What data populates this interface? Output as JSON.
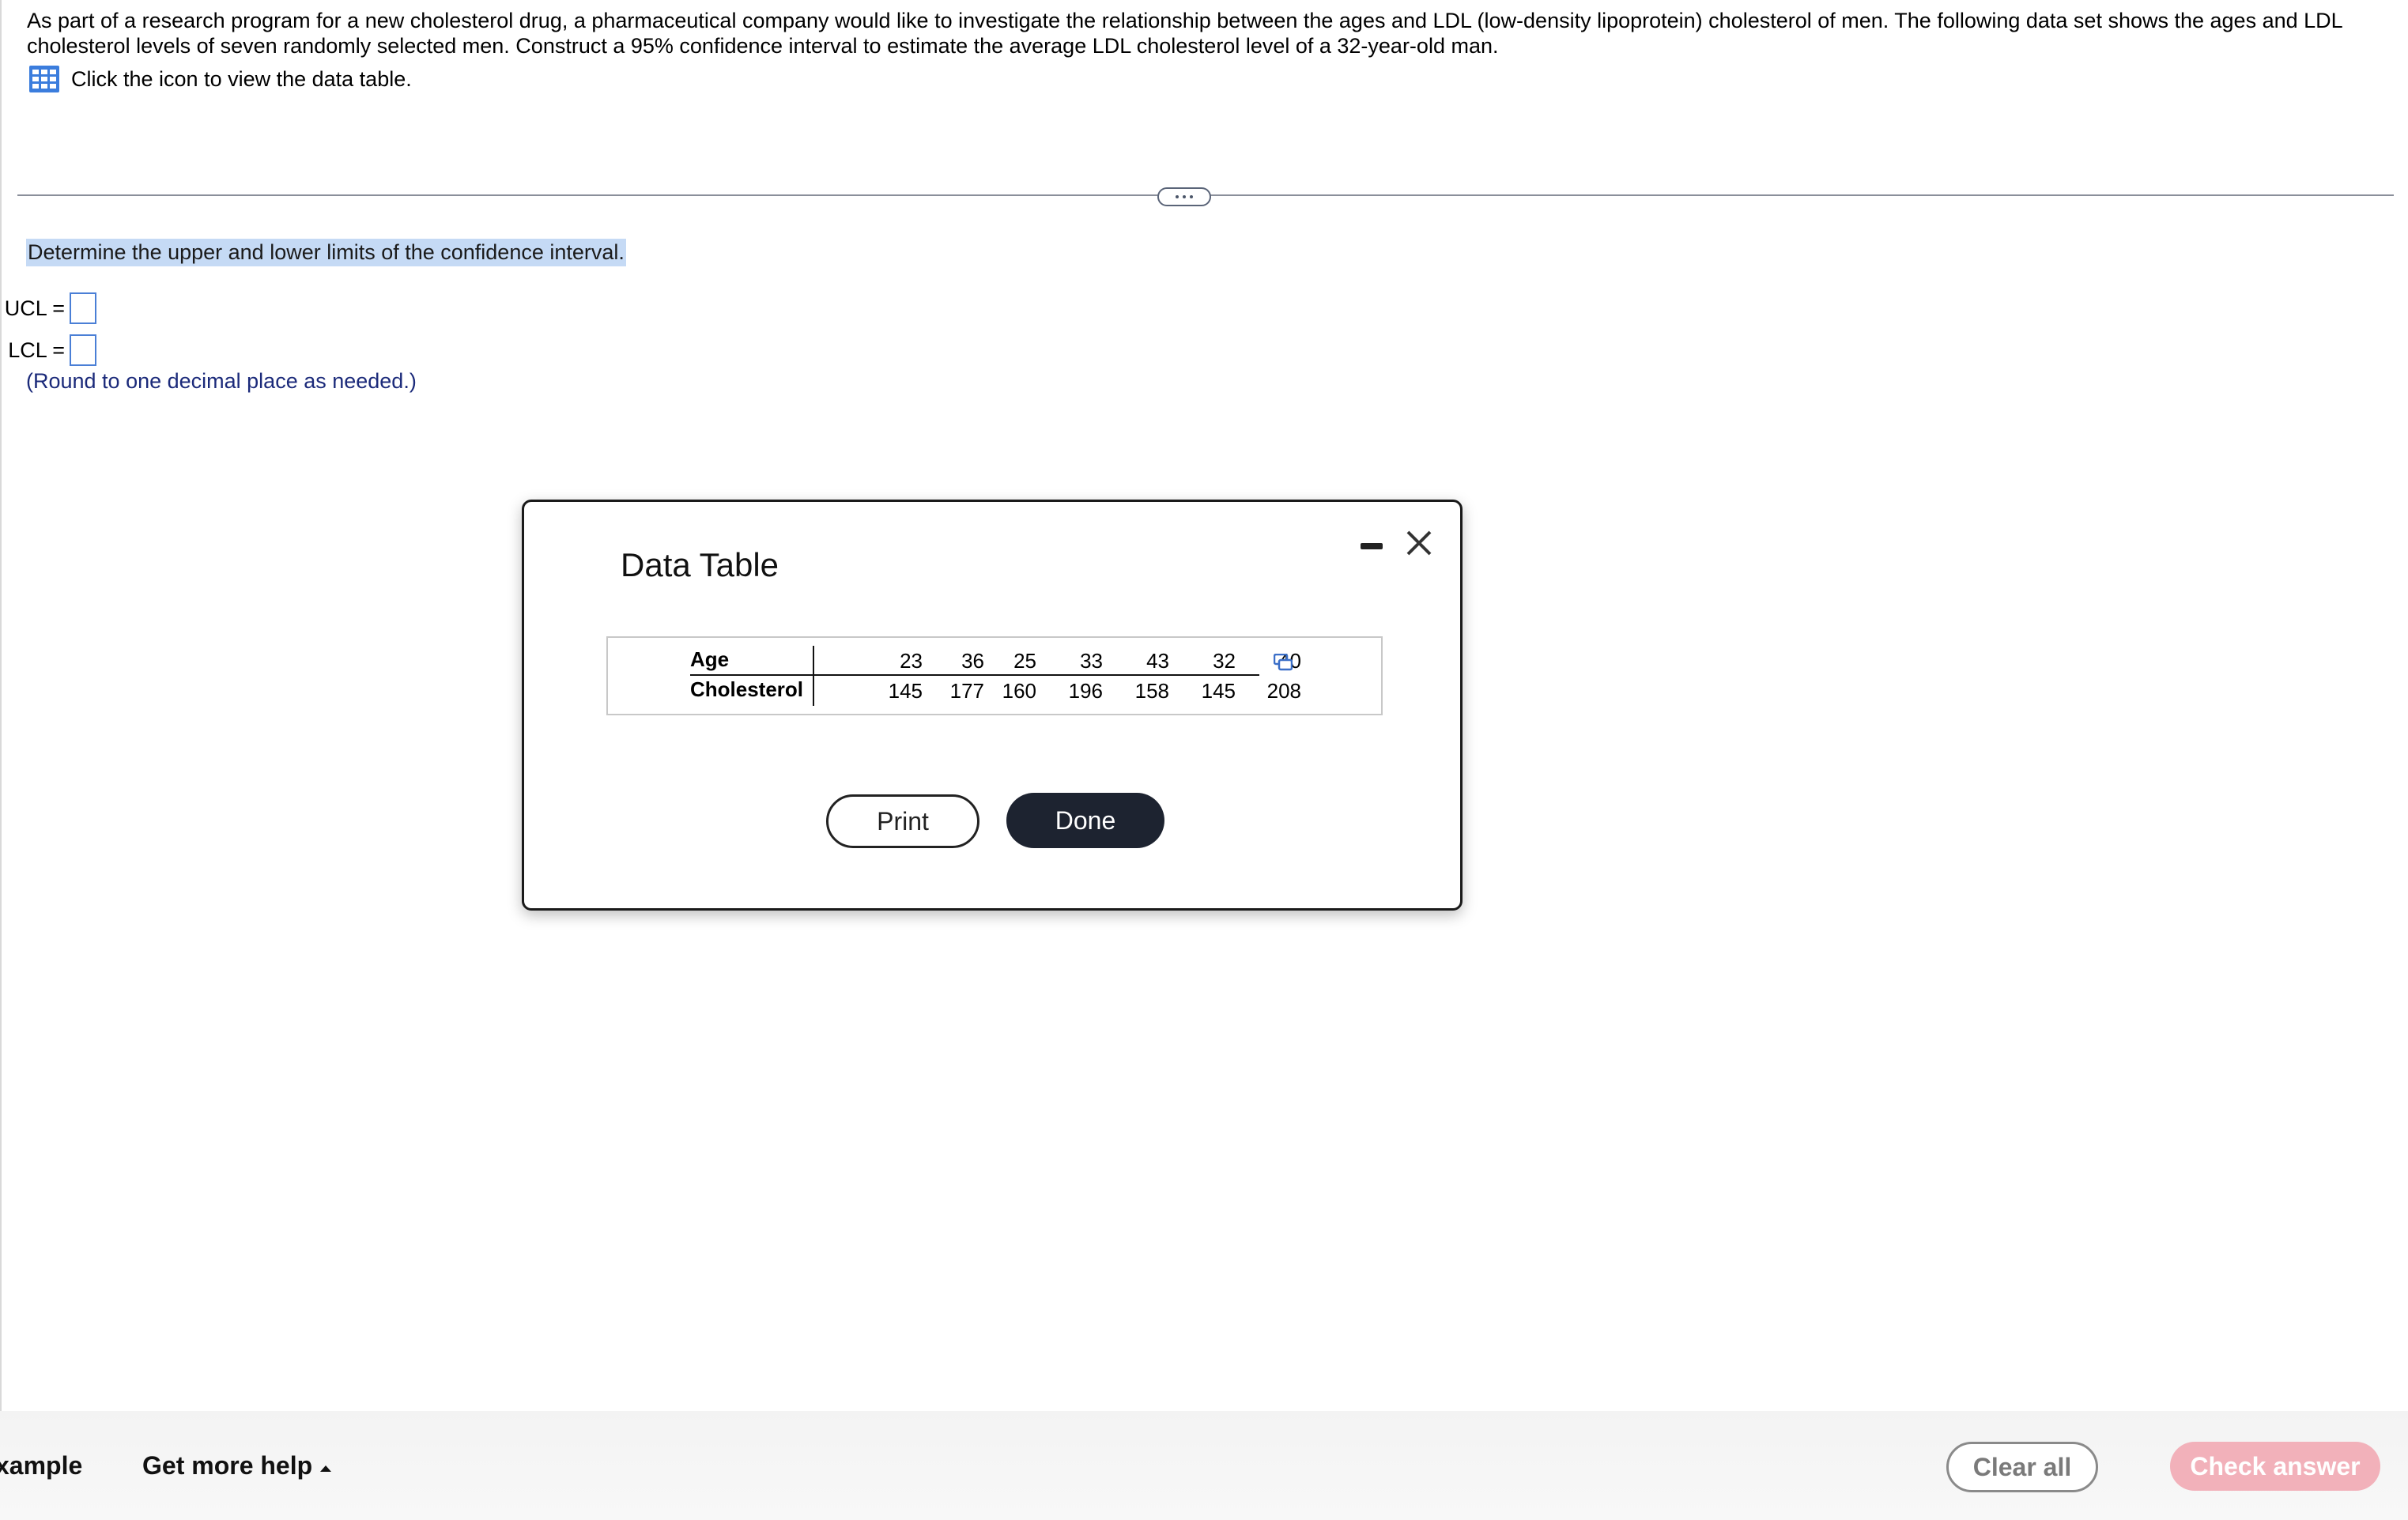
{
  "problem": {
    "text": "As part of a research program for a new cholesterol drug, a pharmaceutical company would like to investigate the relationship between the ages and LDL (low-density lipoprotein) cholesterol of men. The following data set shows the ages and LDL cholesterol levels of seven randomly selected men. Construct a 95% confidence interval to estimate the average LDL cholesterol level of a 32-year-old man.",
    "data_link_label": "Click the icon to view the data table."
  },
  "question": {
    "prompt": "Determine the upper and lower limits of the confidence interval.",
    "ucl_label": "UCL =",
    "lcl_label": "LCL =",
    "ucl_value": "",
    "lcl_value": "",
    "hint": "(Round to one decimal place as needed.)"
  },
  "modal": {
    "title": "Data Table",
    "print_label": "Print",
    "done_label": "Done",
    "table": {
      "row_labels": [
        "Age",
        "Cholesterol"
      ],
      "age": [
        "23",
        "36",
        "25",
        "33",
        "43",
        "32",
        "40"
      ],
      "cholesterol": [
        "145",
        "177",
        "160",
        "196",
        "158",
        "145",
        "208"
      ]
    }
  },
  "footer": {
    "example_label": "xample",
    "help_label": "Get more help",
    "clear_label": "Clear all",
    "check_label": "Check answer"
  },
  "colors": {
    "highlight": "#c5daf5",
    "input_border": "#4a7fd6",
    "hint_text": "#1b2a7a",
    "done_button": "#1d2330",
    "check_button": "#f2b1ba"
  },
  "icons": [
    "data-table-icon",
    "more-dots-icon",
    "minimize-icon",
    "close-icon",
    "copy-icon",
    "caret-up-icon"
  ]
}
